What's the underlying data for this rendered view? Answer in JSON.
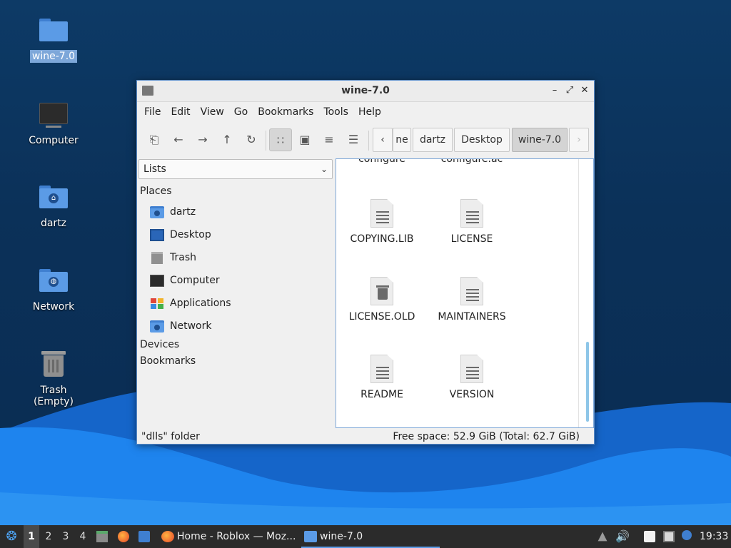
{
  "desktop": {
    "icons": [
      {
        "label": "wine-7.0",
        "selected": true
      },
      {
        "label": "Computer"
      },
      {
        "label": "dartz"
      },
      {
        "label": "Network"
      },
      {
        "label": "Trash (Empty)"
      }
    ]
  },
  "window": {
    "title": "wine-7.0",
    "controls": {
      "minimize": "–",
      "maximize": "⤢",
      "close": "✕"
    },
    "menu": [
      "File",
      "Edit",
      "View",
      "Go",
      "Bookmarks",
      "Tools",
      "Help"
    ],
    "toolbar": {
      "icons": [
        "new-tab-icon",
        "back-icon",
        "forward-icon",
        "up-icon",
        "reload-icon",
        "icon-view-icon",
        "thumbnail-view-icon",
        "compact-view-icon",
        "detailed-list-icon"
      ],
      "glyphs": {
        "new_tab": "⎗",
        "back": "←",
        "forward": "→",
        "up": "↑",
        "reload": "↻",
        "icon_view": "∷",
        "thumb_view": "▣",
        "compact_view": "≡",
        "list_view": "☰"
      }
    },
    "breadcrumbs": {
      "left_arrow": "‹",
      "items": [
        "ne",
        "dartz",
        "Desktop",
        "wine-7.0"
      ],
      "right_arrow": "›",
      "active": "wine-7.0"
    },
    "side_pane": {
      "mode": "Lists",
      "sections": {
        "places": "Places",
        "devices": "Devices",
        "bookmarks": "Bookmarks"
      },
      "places": [
        "dartz",
        "Desktop",
        "Trash",
        "Computer",
        "Applications",
        "Network"
      ]
    },
    "files": {
      "partial_top": [
        "configure",
        "configure.ac"
      ],
      "items": [
        "COPYING.LIB",
        "LICENSE",
        "LICENSE.OLD",
        "MAINTAINERS",
        "README",
        "VERSION"
      ]
    },
    "status": {
      "left": "\"dlls\" folder",
      "right": "Free space: 52.9 GiB (Total: 62.7 GiB)"
    }
  },
  "taskbar": {
    "workspaces": [
      "1",
      "2",
      "3",
      "4"
    ],
    "active_workspace": "1",
    "tasks": [
      {
        "label": "Home - Roblox — Moz...",
        "icon": "firefox-icon"
      },
      {
        "label": "wine-7.0",
        "icon": "folder-icon",
        "current": true
      }
    ],
    "clock": "19:33"
  },
  "colors": {
    "accent": "#5b9be6",
    "desktop": "#0b3159",
    "wave": "#1a7ee8"
  }
}
